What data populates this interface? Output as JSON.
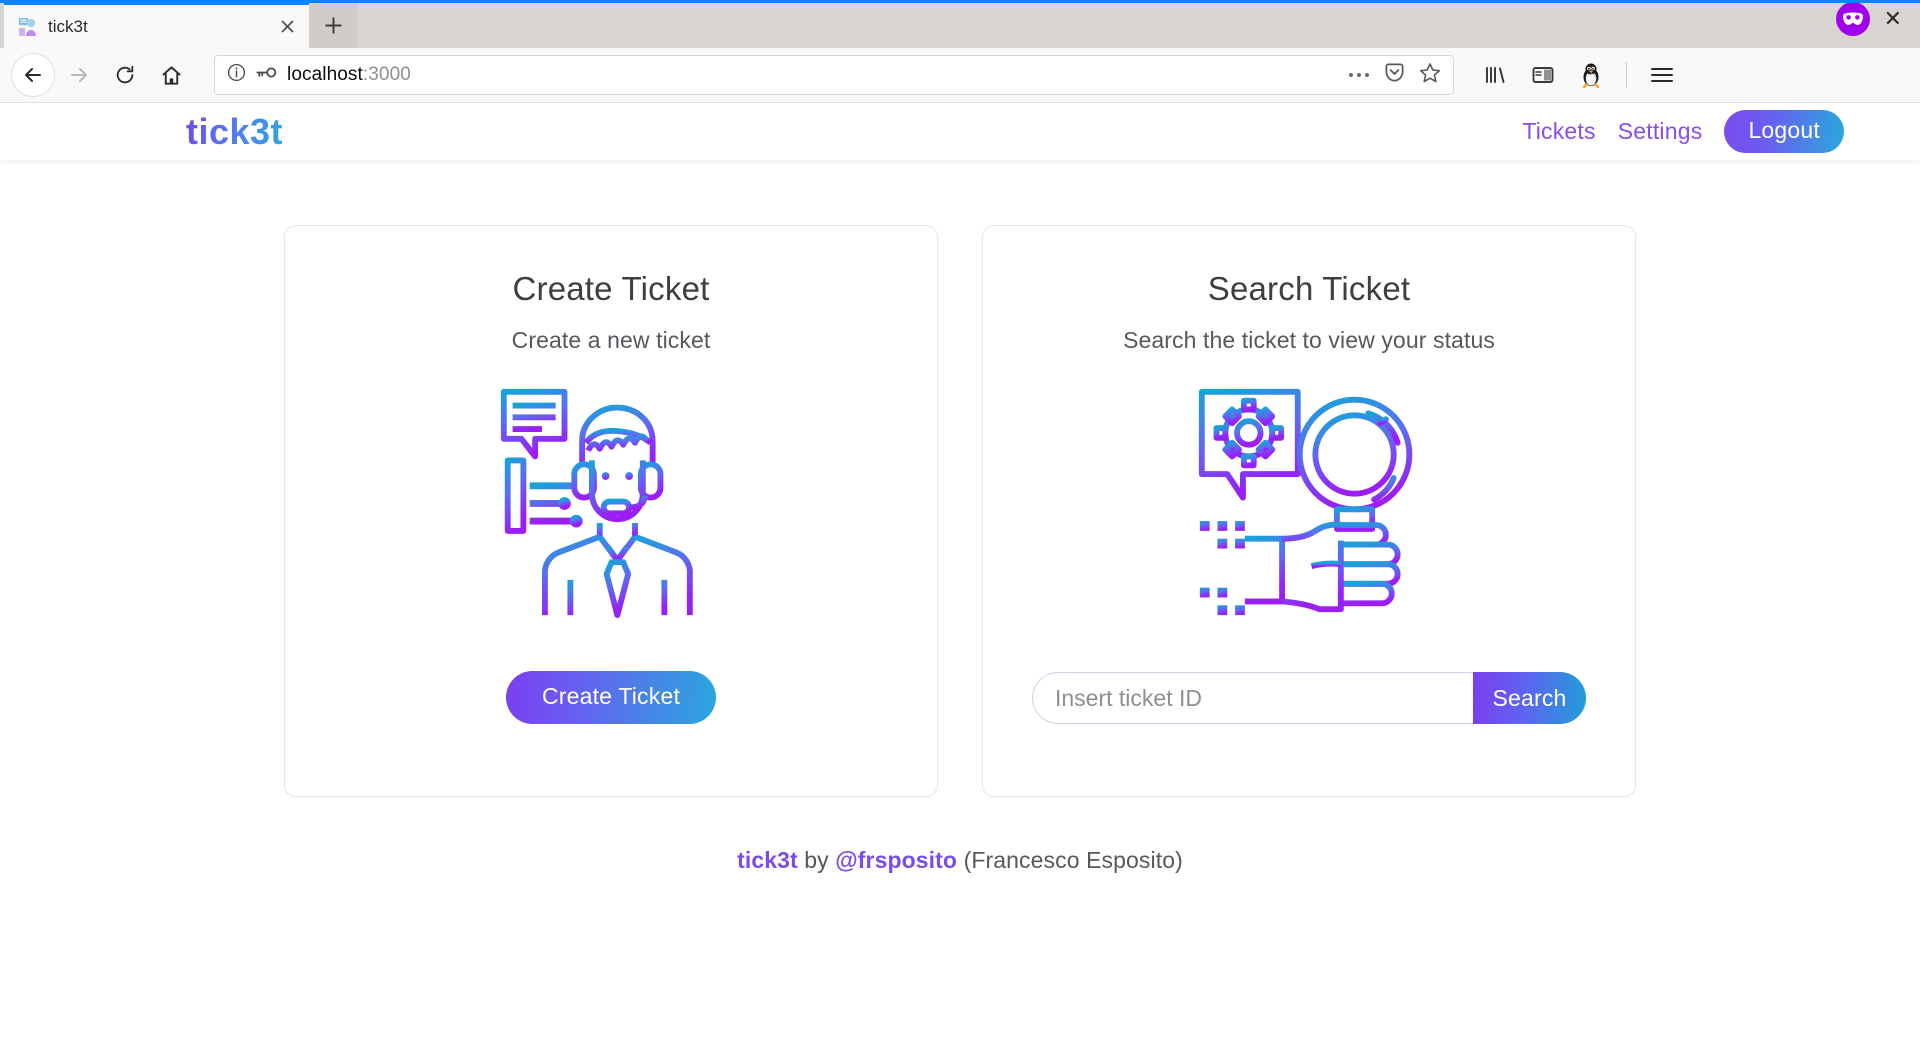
{
  "browser": {
    "tab": {
      "title": "tick3t",
      "favicon_icon": "support-agent-favicon",
      "close_icon": "close-icon"
    },
    "new_tab_label": "+",
    "privacy_badge_icon": "private-mask-icon",
    "window_close_label": "✕",
    "nav": {
      "back_icon": "back-arrow-icon",
      "forward_icon": "forward-arrow-icon",
      "reload_icon": "reload-icon",
      "home_icon": "home-icon"
    },
    "url": {
      "info_icon": "page-info-icon",
      "key_icon": "saved-login-key-icon",
      "host": "localhost",
      "port": ":3000",
      "page_actions_icon": "ellipsis-icon",
      "pocket_icon": "pocket-save-icon",
      "bookmark_icon": "bookmark-star-icon"
    },
    "toolbar": {
      "library_icon": "library-icon",
      "sidebar_icon": "sidebar-icon",
      "extension_icon": "tux-penguin-extension-icon",
      "menu_icon": "hamburger-menu-icon"
    }
  },
  "site": {
    "logo": "tick3t",
    "nav": [
      {
        "label": "Tickets",
        "name": "nav-link-tickets"
      },
      {
        "label": "Settings",
        "name": "nav-link-settings"
      }
    ],
    "logout_label": "Logout"
  },
  "cards": {
    "create": {
      "title": "Create Ticket",
      "subtitle": "Create a new ticket",
      "illustration_icon": "support-agent-illustration",
      "button_label": "Create Ticket"
    },
    "search": {
      "title": "Search Ticket",
      "subtitle": "Search the ticket to view your status",
      "illustration_icon": "magnifier-hand-illustration",
      "input_value": "",
      "input_placeholder": "Insert ticket ID",
      "button_label": "Search"
    }
  },
  "footer": {
    "brand": "tick3t",
    "by": " by ",
    "handle": "@frsposito",
    "author": " (Francesco Esposito)"
  },
  "colors": {
    "accent_purple": "#7c4ce8",
    "accent_cyan": "#2aa7dd",
    "link_purple": "#8b4dea",
    "browser_accent": "#0a84ff",
    "privacy_purple": "#a100ef"
  }
}
